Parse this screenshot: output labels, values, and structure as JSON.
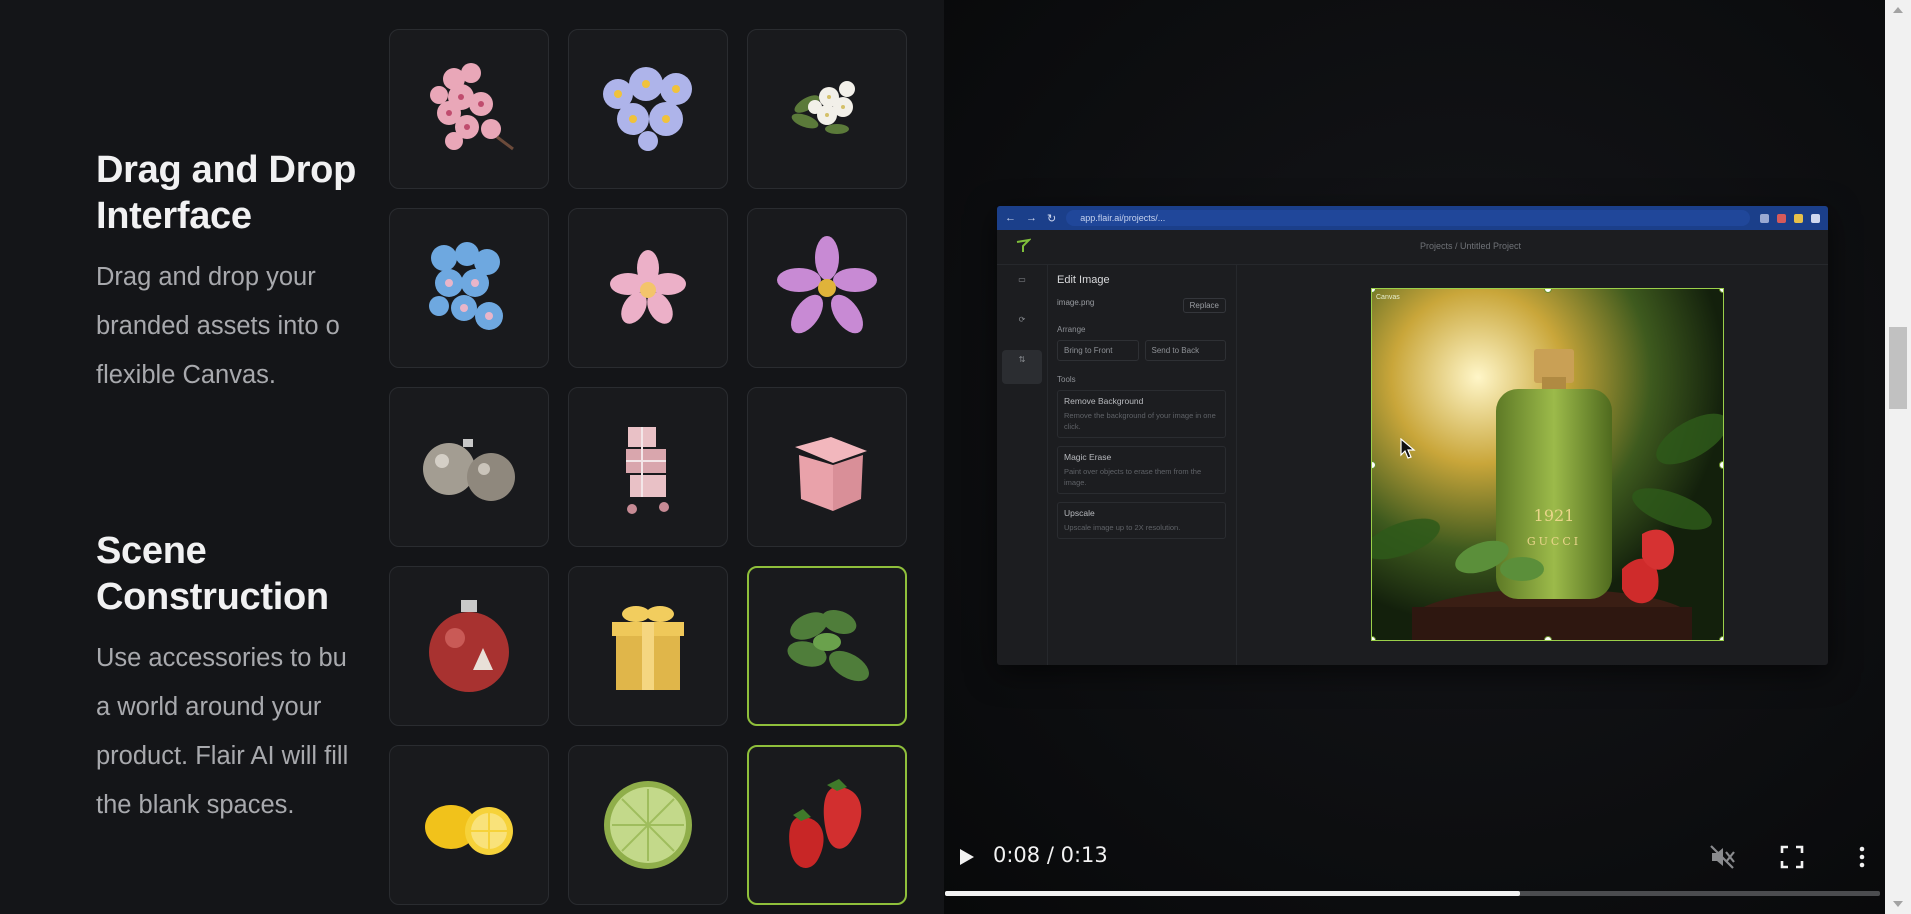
{
  "features": [
    {
      "title_line1": "Drag and Drop",
      "title_line2": "Interface",
      "body_lines": [
        "Drag and drop your",
        "branded assets into o",
        "flexible Canvas."
      ]
    },
    {
      "title_line1": "Scene",
      "title_line2": "Construction",
      "body_lines": [
        "Use accessories to bu",
        "a world around your",
        "product. Flair AI will fill",
        "the blank spaces."
      ]
    }
  ],
  "asset_tiles": [
    {
      "name": "cherry-blossom",
      "selected": false
    },
    {
      "name": "blue-flowers",
      "selected": false
    },
    {
      "name": "white-blossom",
      "selected": false
    },
    {
      "name": "forget-me-not",
      "selected": false
    },
    {
      "name": "plumeria",
      "selected": false
    },
    {
      "name": "cosmos-flower",
      "selected": false
    },
    {
      "name": "silver-ornaments",
      "selected": false
    },
    {
      "name": "pink-gift-stack",
      "selected": false
    },
    {
      "name": "pink-box",
      "selected": false
    },
    {
      "name": "red-ornament",
      "selected": false
    },
    {
      "name": "gold-gift",
      "selected": false
    },
    {
      "name": "mint-leaves",
      "selected": true
    },
    {
      "name": "lemons",
      "selected": false
    },
    {
      "name": "lime-slice",
      "selected": false
    },
    {
      "name": "strawberries",
      "selected": true
    }
  ],
  "video": {
    "time_display": "0:08 / 0:13",
    "progress_fraction": 0.6154,
    "muted": true,
    "browser": {
      "url": "app.flair.ai/projects/...",
      "breadcrumb": "Projects / Untitled Project",
      "panel_title": "Edit Image",
      "file_name": "image.png",
      "replace_label": "Replace",
      "arrange_label": "Arrange",
      "bring_front": "Bring to Front",
      "send_back": "Send to Back",
      "tools_label": "Tools",
      "tools": [
        {
          "title": "Remove Background",
          "desc": "Remove the background of your image in one click."
        },
        {
          "title": "Magic Erase",
          "desc": "Paint over objects to erase them from the image."
        },
        {
          "title": "Upscale",
          "desc": "Upscale image up to 2X resolution."
        }
      ],
      "canvas_tag": "Canvas",
      "product_text": "1921",
      "brand_text": "GUCCI"
    }
  },
  "colors": {
    "background": "#141518",
    "selected_border": "#8fbf3b",
    "browser_bar": "#1b3f8a"
  }
}
